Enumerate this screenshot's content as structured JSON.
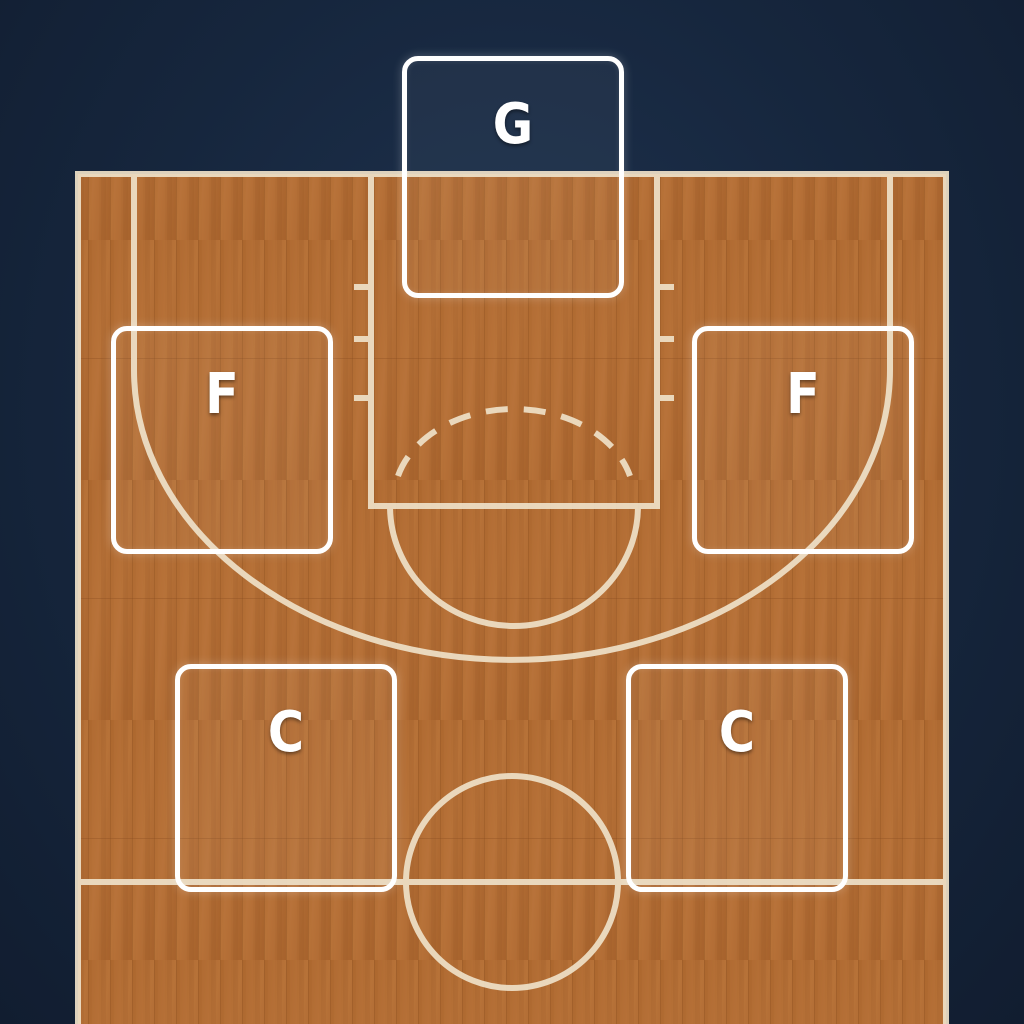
{
  "positions": [
    {
      "id": "slot-g",
      "label": "G"
    },
    {
      "id": "slot-f1",
      "label": "F"
    },
    {
      "id": "slot-f2",
      "label": "F"
    },
    {
      "id": "slot-c1",
      "label": "C"
    },
    {
      "id": "slot-c2",
      "label": "C"
    }
  ],
  "colors": {
    "background": "#16263d",
    "court_wood": "#b06a30",
    "court_lines": "#efe1c8",
    "slot_border": "#ffffff"
  }
}
